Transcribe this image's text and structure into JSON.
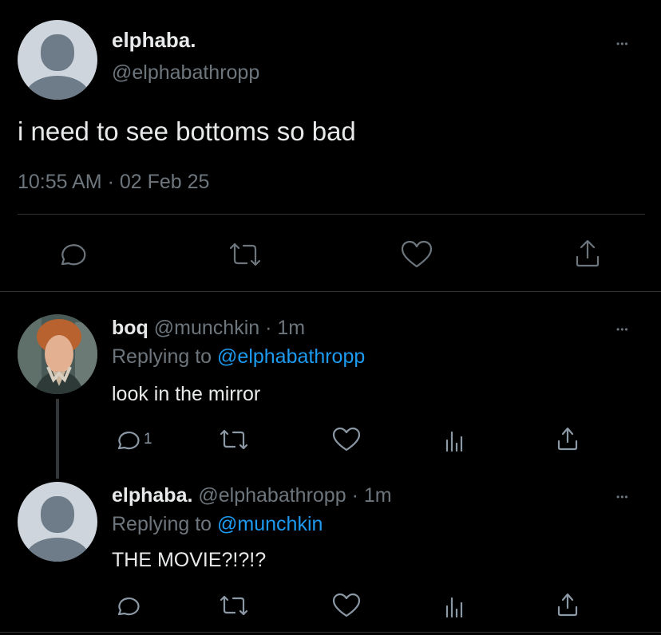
{
  "main_tweet": {
    "display_name": "elphaba.",
    "handle": "@elphabathropp",
    "text": "i need to see bottoms so bad",
    "timestamp": "10:55 AM · 02 Feb 25",
    "more_label": "•••",
    "avatar_icon": "default-avatar-icon"
  },
  "replies": [
    {
      "display_name": "boq",
      "handle": "@munchkin",
      "time": "· 1m",
      "replying_prefix": "Replying to ",
      "replying_to": "@elphabathropp",
      "text": "look in the mirror",
      "reply_count": "1",
      "more_label": "•••",
      "avatar_icon": "profile-photo"
    },
    {
      "display_name": "elphaba.",
      "handle": "@elphabathropp",
      "time": "· 1m",
      "replying_prefix": "Replying to ",
      "replying_to": "@munchkin",
      "text": "THE MOVIE?!?!?",
      "reply_count": "",
      "more_label": "•••",
      "avatar_icon": "default-avatar-icon"
    }
  ],
  "colors": {
    "background": "#000000",
    "text": "#e7e9ea",
    "muted": "#6e767d",
    "link": "#1d9bf0",
    "divider": "#2f3336"
  },
  "icons": [
    "reply-icon",
    "retweet-icon",
    "like-icon",
    "share-icon",
    "views-icon",
    "more-icon"
  ]
}
